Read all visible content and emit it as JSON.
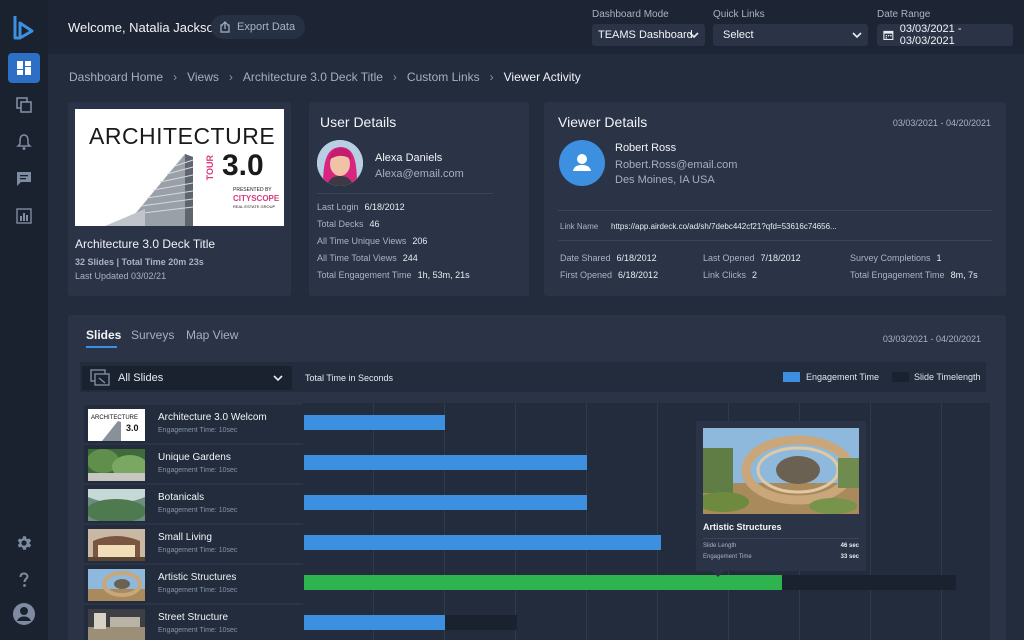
{
  "header": {
    "welcome": "Welcome, Natalia Jackson",
    "export_label": "Export Data",
    "dashboard_mode": {
      "label": "Dashboard Mode",
      "value": "TEAMS Dashboard"
    },
    "quick_links": {
      "label": "Quick Links",
      "value": "Select"
    },
    "date_range": {
      "label": "Date Range",
      "value": "03/03/2021 - 03/03/2021"
    }
  },
  "sidebar": {
    "items": [
      "dashboard",
      "copy",
      "notifications",
      "messages",
      "analytics"
    ],
    "bottom": [
      "settings",
      "help",
      "account"
    ]
  },
  "breadcrumb": [
    "Dashboard Home",
    "Views",
    "Architecture 3.0 Deck Title",
    "Custom Links",
    "Viewer Activity"
  ],
  "deck": {
    "title": "Architecture 3.0 Deck Title",
    "slides_time": "32 Slides | Total Time 20m 23s",
    "updated": "Last Updated 03/02/21",
    "thumb": {
      "line1": "ARCHITECTURE",
      "tour": "TOUR",
      "version": "3.0",
      "presented": "PRESENTED BY",
      "brand": "CITYSCOPE",
      "sub": "REAL ESTATE GROUP"
    }
  },
  "user_details": {
    "title": "User Details",
    "name": "Alexa Daniels",
    "email": "Alexa@email.com",
    "rows": [
      {
        "label": "Last Login",
        "value": "6/18/2012"
      },
      {
        "label": "Total Decks",
        "value": "46"
      },
      {
        "label": "All Time Unique Views",
        "value": "206"
      },
      {
        "label": "All Time Total Views",
        "value": "244"
      },
      {
        "label": "Total Engagement Time",
        "value": "1h, 53m, 21s"
      }
    ]
  },
  "viewer_details": {
    "title": "Viewer Details",
    "date_range": "03/03/2021 - 04/20/2021",
    "name": "Robert Ross",
    "email": "Robert.Ross@email.com",
    "location": "Des Moines, IA  USA",
    "link_label": "Link Name",
    "link_value": "https://app.airdeck.co/ad/sh/7debc442cf21?qfd=53616c74656...",
    "stats": [
      {
        "label": "Date Shared",
        "value": "6/18/2012"
      },
      {
        "label": "Last Opened",
        "value": "7/18/2012"
      },
      {
        "label": "Survey Completions",
        "value": "1"
      },
      {
        "label": "First Opened",
        "value": "6/18/2012"
      },
      {
        "label": "Link Clicks",
        "value": "2"
      },
      {
        "label": "Total Engagement Time",
        "value": "8m, 7s"
      }
    ]
  },
  "panel": {
    "tabs": [
      "Slides",
      "Surveys",
      "Map View"
    ],
    "date_range": "03/03/2021 - 04/20/2021",
    "filter_value": "All Slides",
    "axis_label": "Total Time in Seconds",
    "legend": [
      {
        "name": "Engagement Time",
        "color": "#3d8fe0"
      },
      {
        "name": "Slide Timelength",
        "color": "#1a2230"
      }
    ]
  },
  "slides": [
    {
      "name": "Architecture 3.0 Welcom",
      "eng_label": "Engagement Time:",
      "eng_value": "10sec",
      "engagement_fraction": 0.206,
      "length_fraction": 0.206,
      "highlight": false
    },
    {
      "name": "Unique Gardens",
      "eng_label": "Engagement Time:",
      "eng_value": "10sec",
      "engagement_fraction": 0.413,
      "length_fraction": 0.413,
      "highlight": false
    },
    {
      "name": "Botanicals",
      "eng_label": "Engagement Time:",
      "eng_value": "10sec",
      "engagement_fraction": 0.413,
      "length_fraction": 0.413,
      "highlight": false
    },
    {
      "name": "Small Living",
      "eng_label": "Engagement Time:",
      "eng_value": "10sec",
      "engagement_fraction": 0.52,
      "length_fraction": 0.52,
      "highlight": false
    },
    {
      "name": "Artistic Structures",
      "eng_label": "Engagement Time:",
      "eng_value": "10sec",
      "engagement_fraction": 0.697,
      "length_fraction": 0.95,
      "highlight": true
    },
    {
      "name": "Street Structure",
      "eng_label": "Engagement Time:",
      "eng_value": "10sec",
      "engagement_fraction": 0.206,
      "length_fraction": 0.311,
      "highlight": false
    }
  ],
  "tooltip": {
    "title": "Artistic Structures",
    "rows": [
      {
        "label": "Slide Length",
        "value": "46 sec"
      },
      {
        "label": "Engagement Time",
        "value": "33 sec"
      }
    ]
  }
}
